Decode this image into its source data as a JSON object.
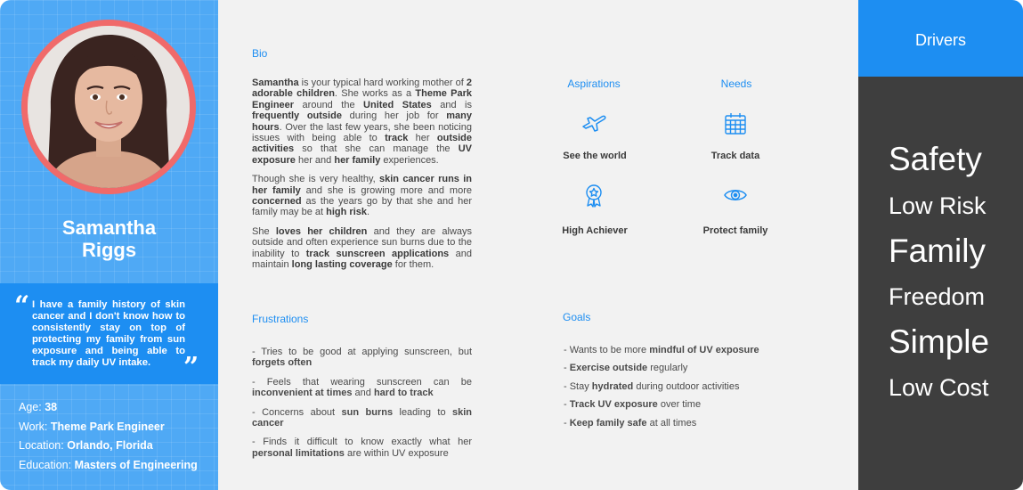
{
  "persona": {
    "first_name": "Samantha",
    "last_name": "Riggs",
    "quote": "I have a family history of skin cancer and I don't know how to consistently stay on top of protecting my family from sun exposure and being able to track my daily UV intake.",
    "quote_open": "“",
    "quote_close": "”",
    "age_label": "Age:",
    "age": "38",
    "work_label": "Work:",
    "work": "Theme Park Engineer",
    "location_label": "Location:",
    "location": "Orlando, Florida",
    "education_label": "Education:",
    "education": "Masters of Engineering"
  },
  "bio": {
    "title": "Bio",
    "paragraphs": [
      [
        {
          "t": "Samantha",
          "b": true
        },
        {
          "t": " is your typical hard working mother of "
        },
        {
          "t": "2 adorable children",
          "b": true
        },
        {
          "t": ". She works as a "
        },
        {
          "t": "Theme Park Engineer",
          "b": true
        },
        {
          "t": " around the "
        },
        {
          "t": "United States",
          "b": true
        },
        {
          "t": " and is "
        },
        {
          "t": "frequently outside",
          "b": true
        },
        {
          "t": " during her job for "
        },
        {
          "t": "many hours",
          "b": true
        },
        {
          "t": ". Over the last few years, she been noticing issues with being able to "
        },
        {
          "t": "track",
          "b": true
        },
        {
          "t": " her "
        },
        {
          "t": "outside activities",
          "b": true
        },
        {
          "t": " so that she can manage the "
        },
        {
          "t": "UV exposure",
          "b": true
        },
        {
          "t": " her and "
        },
        {
          "t": "her family",
          "b": true
        },
        {
          "t": " experiences."
        }
      ],
      [
        {
          "t": "Though she is very healthy, "
        },
        {
          "t": "skin cancer runs in her family",
          "b": true
        },
        {
          "t": " and she is growing more and more "
        },
        {
          "t": "concerned",
          "b": true
        },
        {
          "t": " as the years go by that she and her family may be at "
        },
        {
          "t": "high risk",
          "b": true
        },
        {
          "t": "."
        }
      ],
      [
        {
          "t": "She "
        },
        {
          "t": "loves her children",
          "b": true
        },
        {
          "t": " and they are always outside and often experience sun burns due to the inability to "
        },
        {
          "t": "track sunscreen applications",
          "b": true
        },
        {
          "t": " and maintain "
        },
        {
          "t": "long lasting coverage",
          "b": true
        },
        {
          "t": " for them."
        }
      ]
    ]
  },
  "aspirations": {
    "title": "Aspirations",
    "items": [
      {
        "label": "See the world",
        "icon": "airplane-icon"
      },
      {
        "label": "High Achiever",
        "icon": "award-icon"
      }
    ]
  },
  "needs": {
    "title": "Needs",
    "items": [
      {
        "label": "Track data",
        "icon": "calendar-icon"
      },
      {
        "label": "Protect family",
        "icon": "eye-icon"
      }
    ]
  },
  "frustrations": {
    "title": "Frustrations",
    "items": [
      [
        {
          "t": "-   Tries to be good at applying sunscreen, but "
        },
        {
          "t": "forgets often",
          "b": true
        }
      ],
      [
        {
          "t": "-   Feels that wearing sunscreen can be "
        },
        {
          "t": "inconvenient at times",
          "b": true
        },
        {
          "t": " and "
        },
        {
          "t": "hard to track",
          "b": true
        }
      ],
      [
        {
          "t": "-   Concerns about "
        },
        {
          "t": "sun burns",
          "b": true
        },
        {
          "t": " leading to "
        },
        {
          "t": "skin cancer",
          "b": true
        }
      ],
      [
        {
          "t": "-   Finds it difficult to know exactly what her "
        },
        {
          "t": "personal limitations",
          "b": true
        },
        {
          "t": " are within UV exposure"
        }
      ]
    ]
  },
  "goals": {
    "title": "Goals",
    "items": [
      [
        {
          "t": "-   Wants to be more "
        },
        {
          "t": "mindful of UV exposure",
          "b": true
        }
      ],
      [
        {
          "t": "-   "
        },
        {
          "t": "Exercise outside",
          "b": true
        },
        {
          "t": " regularly"
        }
      ],
      [
        {
          "t": "-   Stay "
        },
        {
          "t": "hydrated",
          "b": true
        },
        {
          "t": " during outdoor activities"
        }
      ],
      [
        {
          "t": "-   "
        },
        {
          "t": "Track UV exposure",
          "b": true
        },
        {
          "t": " over time"
        }
      ],
      [
        {
          "t": "-   "
        },
        {
          "t": "Keep family safe",
          "b": true
        },
        {
          "t": " at all times"
        }
      ]
    ]
  },
  "drivers": {
    "title": "Drivers",
    "items": [
      "Safety",
      "Low Risk",
      "Family",
      "Freedom",
      "Simple",
      "Low Cost"
    ]
  },
  "colors": {
    "accent": "#1d8ef2",
    "left_panel": "#4fa9f5",
    "dark_panel": "#3e3e3e",
    "avatar_ring": "#f06a6a",
    "background": "#f2f2f2"
  }
}
